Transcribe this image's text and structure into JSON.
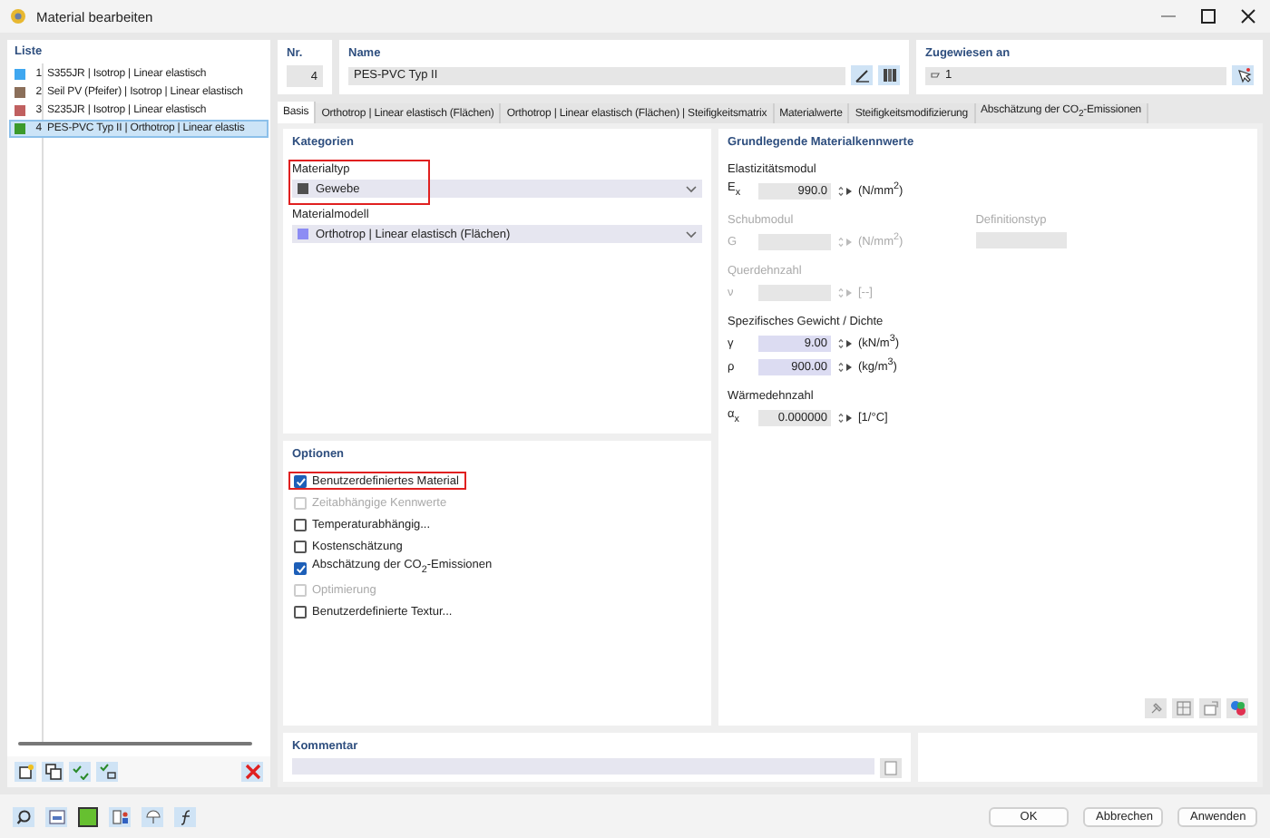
{
  "window": {
    "title": "Material bearbeiten"
  },
  "list": {
    "title": "Liste",
    "items": [
      {
        "number": "1",
        "label": "S355JR | Isotrop | Linear elastisch",
        "color": "#3fa7f0",
        "selected": false
      },
      {
        "number": "2",
        "label": "Seil PV (Pfeifer) | Isotrop | Linear elastisch",
        "color": "#8b6f5a",
        "selected": false
      },
      {
        "number": "3",
        "label": "S235JR | Isotrop | Linear elastisch",
        "color": "#c06060",
        "selected": false
      },
      {
        "number": "4",
        "label": "PES-PVC Typ II | Orthotrop | Linear elastis",
        "color": "#3c9a2c",
        "selected": true
      }
    ]
  },
  "header": {
    "number": {
      "label": "Nr.",
      "value": "4"
    },
    "name": {
      "label": "Name",
      "value": "PES-PVC Typ II"
    },
    "assigned": {
      "label": "Zugewiesen an",
      "value": "1"
    }
  },
  "tabs": [
    {
      "label": "Basis",
      "selected": true
    },
    {
      "label": "Orthotrop | Linear elastisch (Flächen)",
      "selected": false
    },
    {
      "label": "Orthotrop | Linear elastisch (Flächen) | Steifigkeitsmatrix",
      "selected": false
    },
    {
      "label": "Materialwerte",
      "selected": false
    },
    {
      "label": "Steifigkeitsmodifizierung",
      "selected": false
    },
    {
      "label": "Abschätzung der CO$_{2}$-Emissionen",
      "selected": false
    }
  ],
  "categories": {
    "title": "Kategorien",
    "fields": [
      {
        "label": "Materialtyp",
        "value": "Gewebe",
        "color": "#505050",
        "highlighted": true
      },
      {
        "label": "Materialmodell",
        "value": "Orthotrop | Linear elastisch (Flächen)",
        "color": "#8c8cf4",
        "highlighted": false
      }
    ]
  },
  "options": {
    "title": "Optionen",
    "items": [
      {
        "label": "Benutzerdefiniertes Material",
        "checked": true,
        "disabled": false,
        "highlighted": true
      },
      {
        "label": "Zeitabhängige Kennwerte",
        "checked": false,
        "disabled": true,
        "highlighted": false
      },
      {
        "label": "Temperaturabhängig...",
        "checked": false,
        "disabled": false,
        "highlighted": false
      },
      {
        "label": "Kostenschätzung",
        "checked": false,
        "disabled": false,
        "highlighted": false
      },
      {
        "label": "Abschätzung der CO$_{2}$-Emissionen",
        "checked": true,
        "disabled": false,
        "highlighted": false
      },
      {
        "label": "Optimierung",
        "checked": false,
        "disabled": true,
        "highlighted": false
      },
      {
        "label": "Benutzerdefinierte Textur...",
        "checked": false,
        "disabled": false,
        "highlighted": false
      }
    ]
  },
  "properties": {
    "title": "Grundlegende Materialkennwerte",
    "groups": [
      {
        "label": "Elastizitätsmodul",
        "disabled": false,
        "rows": [
          {
            "symbol": "E$_{x}$",
            "value": "990.0",
            "unit": "(N/mm$^{2}$)",
            "editable": false
          }
        ]
      },
      {
        "label": "Schubmodul",
        "disabled": true,
        "rows": [
          {
            "symbol": "G",
            "unit": "(N/mm$^{2}$)",
            "editable": false
          }
        ],
        "side_field": {
          "label": "Definitionstyp"
        }
      },
      {
        "label": "Querdehnzahl",
        "disabled": true,
        "rows": [
          {
            "symbol": "ν",
            "unit": "[--]",
            "editable": false
          }
        ]
      },
      {
        "label": "Spezifisches Gewicht / Dichte",
        "disabled": false,
        "rows": [
          {
            "symbol": "γ",
            "value": "9.00",
            "unit": "(kN/m$^{3}$)",
            "editable": true
          },
          {
            "symbol": "ρ",
            "value": "900.00",
            "unit": "(kg/m$^{3}$)",
            "editable": true
          }
        ]
      },
      {
        "label": "Wärmedehnzahl",
        "disabled": false,
        "rows": [
          {
            "symbol": "α$_{x}$",
            "value": "0.000000",
            "unit": "[1/°C]",
            "editable": false
          }
        ]
      }
    ]
  },
  "comment": {
    "label": "Kommentar"
  },
  "buttons": [
    "OK",
    "Abbrechen",
    "Anwenden"
  ]
}
